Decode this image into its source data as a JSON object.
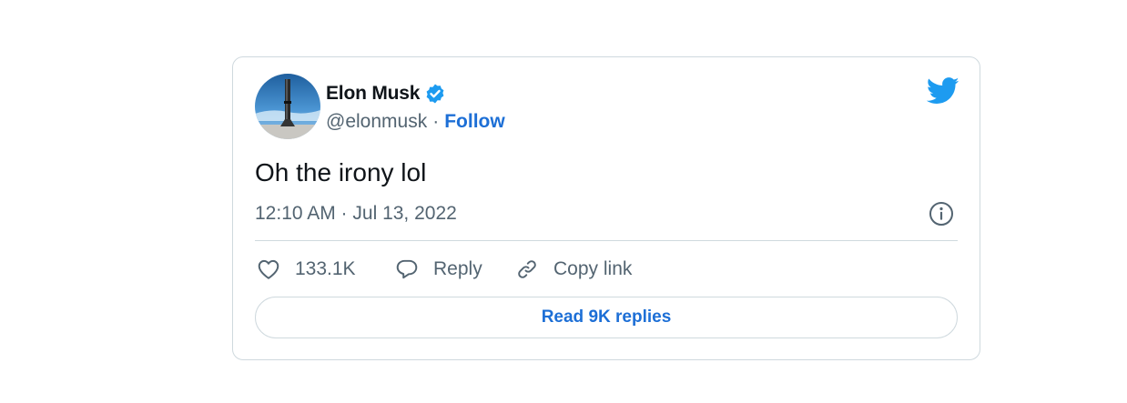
{
  "author": {
    "name": "Elon Musk",
    "handle": "@elonmusk",
    "separator": "·",
    "follow_label": "Follow",
    "verified": true
  },
  "tweet": {
    "text": "Oh the irony lol",
    "timestamp": "12:10 AM · Jul 13, 2022"
  },
  "actions": {
    "like_count": "133.1K",
    "reply_label": "Reply",
    "copy_link_label": "Copy link"
  },
  "footer": {
    "read_replies_label": "Read 9K replies"
  },
  "icons": {
    "brand": "twitter-bird-icon",
    "verified": "verified-badge-icon",
    "info": "info-icon",
    "like": "heart-icon",
    "reply": "speech-bubble-icon",
    "copy_link": "link-icon"
  },
  "colors": {
    "accent": "#1d9bf0",
    "link": "#1d6fd6",
    "text_primary": "#0f1419",
    "text_secondary": "#536471",
    "border": "#cfd9de"
  }
}
